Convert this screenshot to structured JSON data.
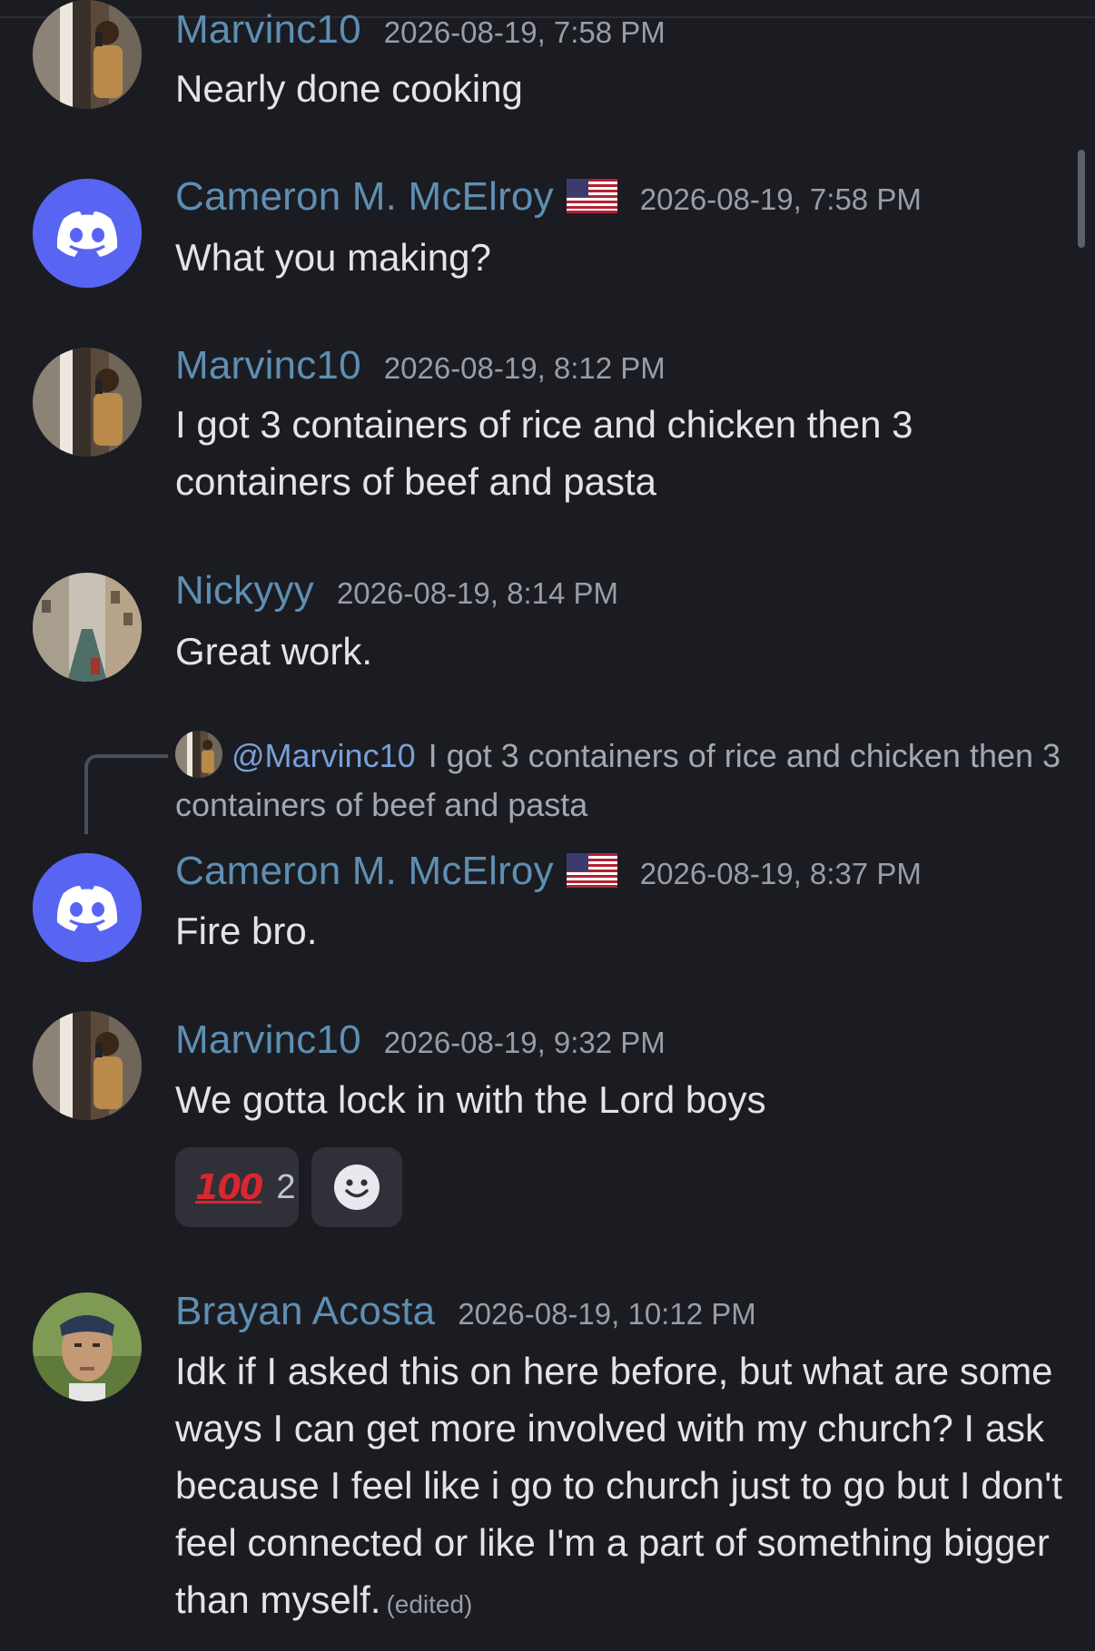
{
  "colors": {
    "background": "#1b1c22",
    "author": "#5e8fb2",
    "timestamp": "#9a9ca6",
    "message_text": "#e3e4e8",
    "discord_blurple": "#5865f2",
    "reaction_bg": "#2f3038",
    "mention": "#7a9fd8"
  },
  "messages": [
    {
      "author": "Marvinc10",
      "timestamp": "2026-08-19, 7:58 PM",
      "text": "Nearly done cooking",
      "avatar": "photo-avatar-marvinc10"
    },
    {
      "author": "Cameron M. McElroy",
      "flag": "us-flag-icon",
      "timestamp": "2026-08-19, 7:58 PM",
      "text": "What you making?",
      "avatar": "discord-logo-icon"
    },
    {
      "author": "Marvinc10",
      "timestamp": "2026-08-19, 8:12 PM",
      "text": "I got 3 containers  of rice and chicken then 3 containers of beef and pasta",
      "avatar": "photo-avatar-marvinc10"
    },
    {
      "author": "Nickyyy",
      "timestamp": "2026-08-19, 8:14 PM",
      "text": "Great work.",
      "avatar": "photo-avatar-canal"
    },
    {
      "reply_to": {
        "mention": "@Marvinc10",
        "text": "I got 3 containers  of rice and chicken then 3 containers of beef and pasta"
      },
      "author": "Cameron M. McElroy",
      "flag": "us-flag-icon",
      "timestamp": "2026-08-19, 8:37 PM",
      "text": "Fire bro.",
      "avatar": "discord-logo-icon"
    },
    {
      "author": "Marvinc10",
      "timestamp": "2026-08-19, 9:32 PM",
      "text": "We gotta lock in with the Lord boys",
      "avatar": "photo-avatar-marvinc10",
      "reactions": [
        {
          "emoji": "100",
          "emoji_name": "hundred-points-icon",
          "count": "2"
        },
        {
          "emoji_name": "add-reaction-smile-icon"
        }
      ]
    },
    {
      "author": "Brayan Acosta",
      "timestamp": "2026-08-19, 10:12 PM",
      "text": "Idk if I asked this on here before, but what are some ways I can get more involved with my church? I ask because I feel like i go to church just to go but I don't feel connected or like I'm a part of something bigger than myself.",
      "edited_label": "(edited)",
      "avatar": "photo-avatar-brayan"
    }
  ]
}
